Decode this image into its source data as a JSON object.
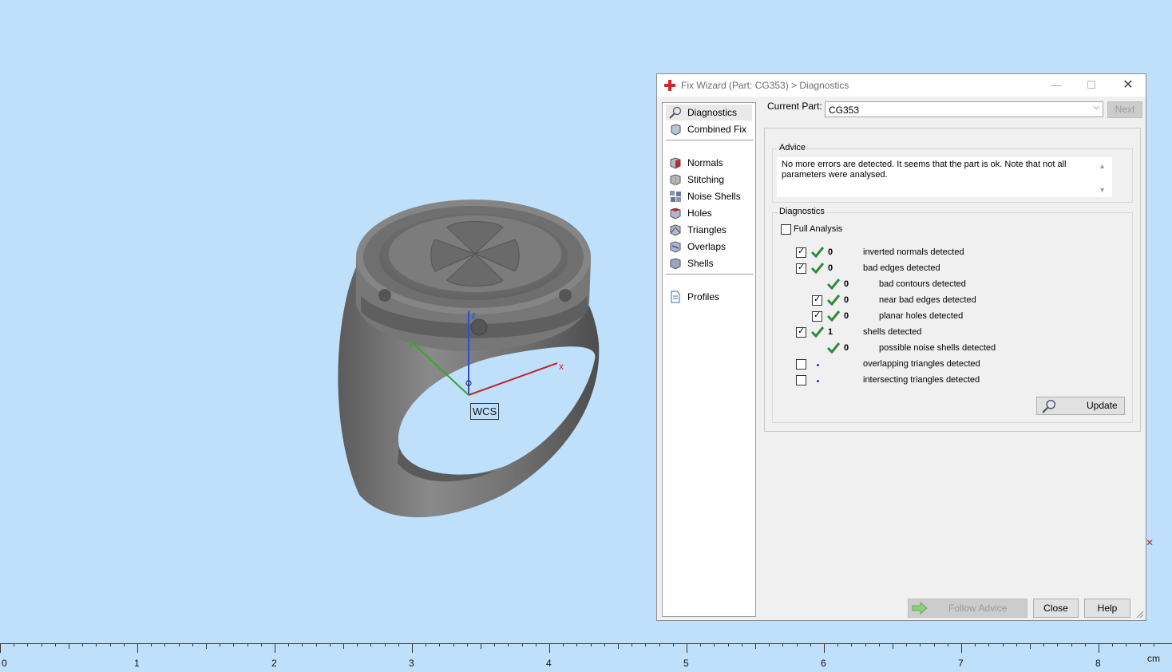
{
  "viewport": {
    "wcs_label": "WCS",
    "axis_x_label": "x",
    "axis_y_label": "y",
    "axis_z_label": "z"
  },
  "dialog": {
    "title": "Fix Wizard (Part: CG353) > Diagnostics",
    "nav": {
      "items": [
        {
          "label": "Diagnostics",
          "icon": "magnifier-icon"
        },
        {
          "label": "Combined Fix",
          "icon": "cube-icon"
        },
        {
          "label": "Normals",
          "icon": "normals-cube-icon"
        },
        {
          "label": "Stitching",
          "icon": "stitching-cube-icon"
        },
        {
          "label": "Noise Shells",
          "icon": "noise-shells-icon"
        },
        {
          "label": "Holes",
          "icon": "holes-cube-icon"
        },
        {
          "label": "Triangles",
          "icon": "triangles-cube-icon"
        },
        {
          "label": "Overlaps",
          "icon": "overlaps-cube-icon"
        },
        {
          "label": "Shells",
          "icon": "shells-cube-icon"
        },
        {
          "label": "Profiles",
          "icon": "document-icon"
        }
      ]
    },
    "current_part_label": "Current Part:",
    "current_part_value": "CG353",
    "next_label": "Next",
    "advice": {
      "title": "Advice",
      "text": "No more errors are detected. It seems that the part is ok. Note that not all parameters were analysed."
    },
    "diagnostics": {
      "title": "Diagnostics",
      "full_analysis_label": "Full Analysis",
      "rows": [
        {
          "checked": true,
          "status": "ok",
          "count": "0",
          "label": "inverted normals detected"
        },
        {
          "checked": true,
          "status": "ok",
          "count": "0",
          "label": "bad edges detected"
        },
        {
          "checked": null,
          "status": "ok",
          "count": "0",
          "label": "bad contours detected"
        },
        {
          "checked": true,
          "status": "ok",
          "count": "0",
          "label": "near bad edges detected"
        },
        {
          "checked": true,
          "status": "ok",
          "count": "0",
          "label": "planar holes detected"
        },
        {
          "checked": true,
          "status": "ok",
          "count": "1",
          "label": "shells detected"
        },
        {
          "checked": null,
          "status": "ok",
          "count": "0",
          "label": "possible noise shells detected"
        },
        {
          "checked": false,
          "status": "pending",
          "count": "",
          "label": "overlapping triangles detected"
        },
        {
          "checked": false,
          "status": "pending",
          "count": "",
          "label": "intersecting triangles detected"
        }
      ],
      "update_label": "Update"
    },
    "follow_advice_label": "Follow Advice",
    "close_label": "Close",
    "help_label": "Help"
  },
  "ruler": {
    "ticks": [
      "0",
      "1",
      "2",
      "3",
      "4",
      "5",
      "6",
      "7",
      "8"
    ],
    "unit": "cm"
  },
  "colors": {
    "viewport_bg": "#bfe0fb",
    "ring": "#6e6e6e",
    "check_green": "#2e8b3a",
    "axis_x": "#c0262d",
    "axis_y": "#3aa52a",
    "axis_z": "#2a50d0"
  }
}
